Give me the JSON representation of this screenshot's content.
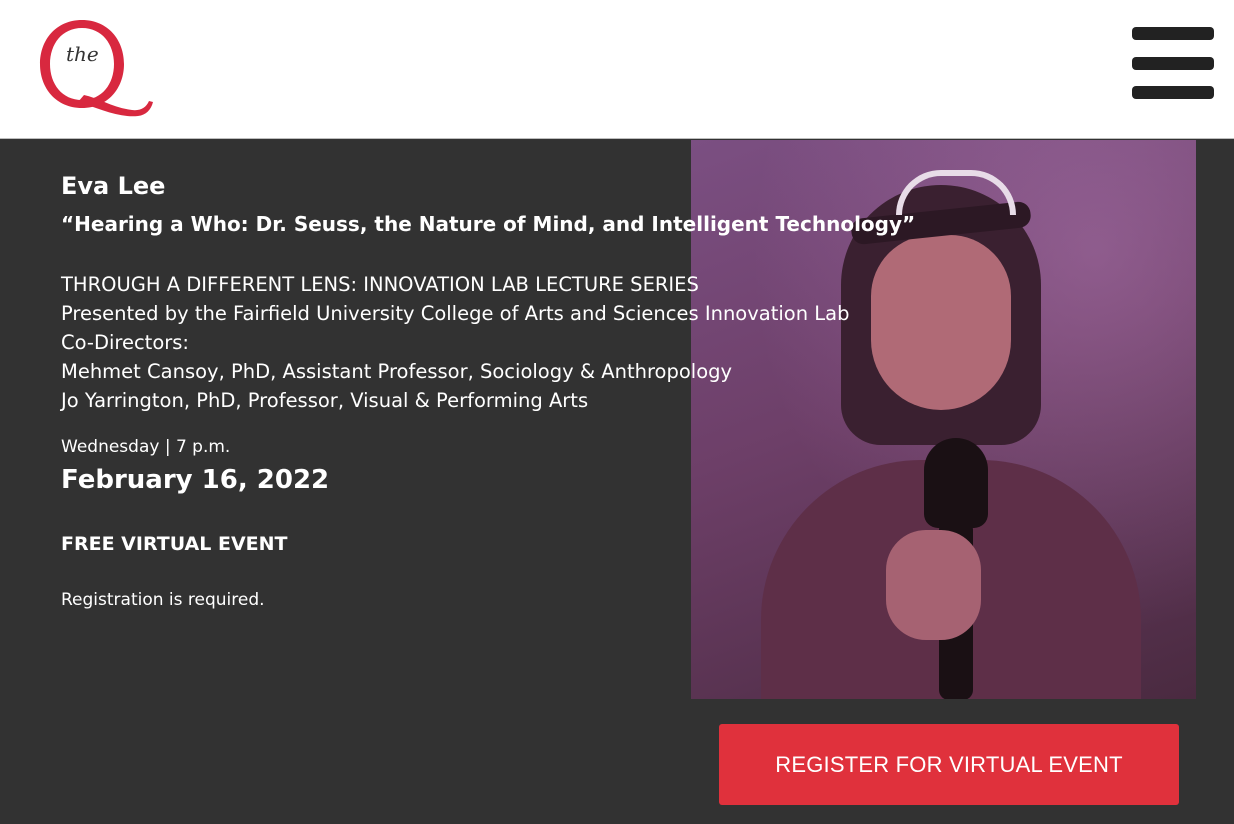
{
  "header": {
    "logo_text": "the",
    "logo_color": "#d8283f",
    "menu_icon": "hamburger-menu-icon"
  },
  "event": {
    "speaker": "Eva Lee",
    "title": "“Hearing a Who: Dr. Seuss, the Nature of Mind, and Intelligent Technology”",
    "series_lines": [
      "THROUGH A DIFFERENT LENS: INNOVATION LAB LECTURE SERIES",
      "Presented by the Fairfield University College of Arts and Sciences Innovation Lab",
      "Co-Directors:",
      "Mehmet Cansoy, PhD, Assistant Professor, Sociology & Anthropology",
      "Jo Yarrington, PhD, Professor, Visual & Performing Arts"
    ],
    "day_time": "Wednesday | 7 p.m.",
    "date": "February 16, 2022",
    "admission": "FREE VIRTUAL EVENT",
    "registration_note": "Registration is required."
  },
  "photo": {
    "alt": "Eva Lee speaking into a microphone"
  },
  "register_button": {
    "label": "REGISTER FOR VIRTUAL EVENT",
    "color": "#e0313c"
  }
}
